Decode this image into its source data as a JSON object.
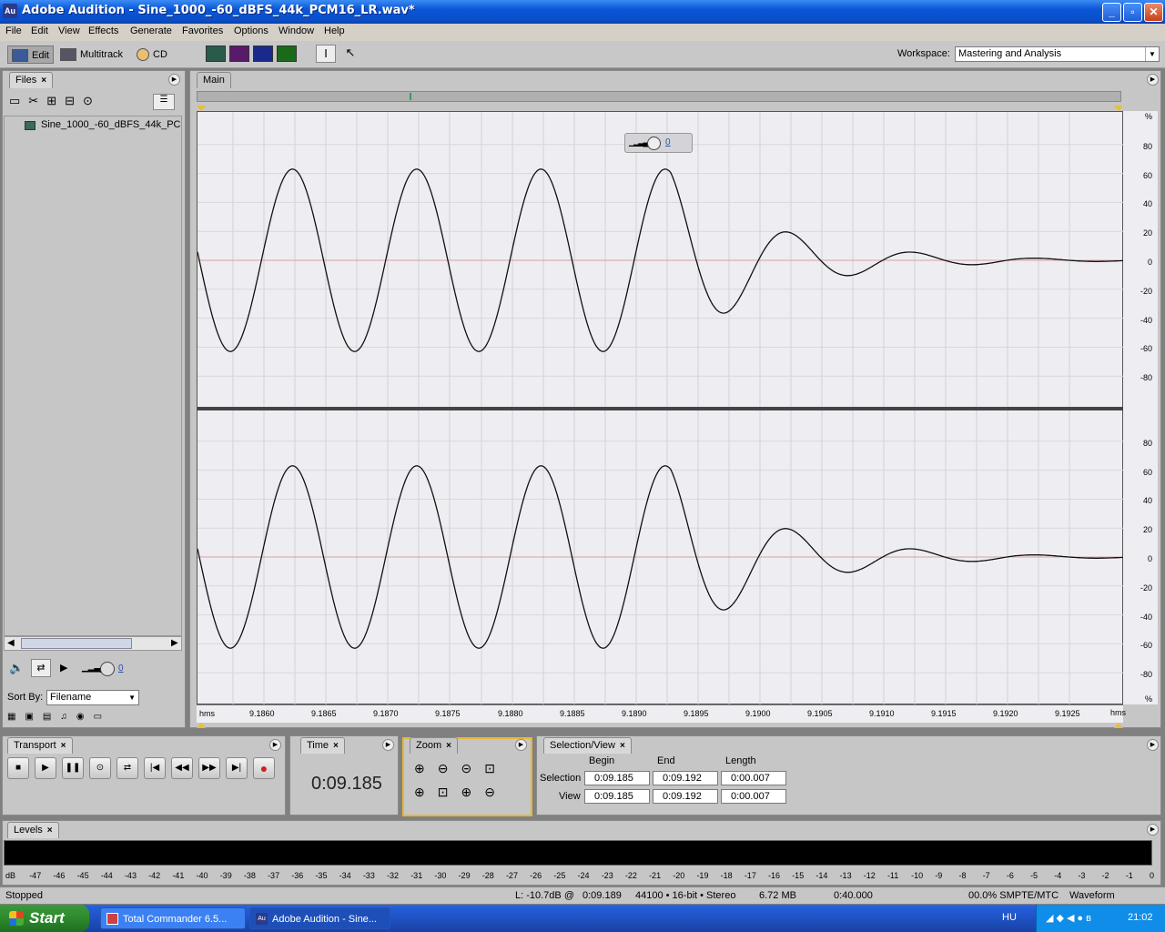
{
  "window": {
    "title": "Adobe Audition - Sine_1000_-60_dBFS_44k_PCM16_LR.wav*",
    "app_icon": "Au"
  },
  "menu": [
    "File",
    "Edit",
    "View",
    "Effects",
    "Generate",
    "Favorites",
    "Options",
    "Window",
    "Help"
  ],
  "toolbar": {
    "edit": "Edit",
    "multitrack": "Multitrack",
    "cd": "CD",
    "workspace_label": "Workspace:",
    "workspace_value": "Mastering and Analysis"
  },
  "files_panel": {
    "tab": "Files",
    "file": "Sine_1000_-60_dBFS_44k_PCM",
    "sort_label": "Sort By:",
    "sort_value": "Filename",
    "volume": "0"
  },
  "main_panel": {
    "tab": "Main",
    "overlay_volume": "0"
  },
  "waveform": {
    "y_labels_top": [
      "%",
      "80",
      "60",
      "40",
      "20",
      "0",
      "-20",
      "-40",
      "-60",
      "-80"
    ],
    "y_labels_bottom": [
      "80",
      "60",
      "40",
      "20",
      "0",
      "-20",
      "-40",
      "-60",
      "-80",
      "%"
    ],
    "x_unit": "hms",
    "x_ticks": [
      "9.1860",
      "9.1865",
      "9.1870",
      "9.1875",
      "9.1880",
      "9.1885",
      "9.1890",
      "9.1895",
      "9.1900",
      "9.1905",
      "9.1910",
      "9.1915",
      "9.1920",
      "9.1925"
    ],
    "peaks_note": "decaying sine"
  },
  "transport": {
    "tab": "Transport"
  },
  "time_panel": {
    "tab": "Time",
    "value": "0:09.185"
  },
  "zoom_panel": {
    "tab": "Zoom"
  },
  "selection_view": {
    "tab": "Selection/View",
    "col_begin": "Begin",
    "col_end": "End",
    "col_length": "Length",
    "row_selection": "Selection",
    "row_view": "View",
    "sel_begin": "0:09.185",
    "sel_end": "0:09.192",
    "sel_length": "0:00.007",
    "view_begin": "0:09.185",
    "view_end": "0:09.192",
    "view_length": "0:00.007"
  },
  "levels": {
    "tab": "Levels",
    "scale": [
      "dB",
      "-47",
      "-46",
      "-45",
      "-44",
      "-43",
      "-42",
      "-41",
      "-40",
      "-39",
      "-38",
      "-37",
      "-36",
      "-35",
      "-34",
      "-33",
      "-32",
      "-31",
      "-30",
      "-29",
      "-28",
      "-27",
      "-26",
      "-25",
      "-24",
      "-23",
      "-22",
      "-21",
      "-20",
      "-19",
      "-18",
      "-17",
      "-16",
      "-15",
      "-14",
      "-13",
      "-12",
      "-11",
      "-10",
      "-9",
      "-8",
      "-7",
      "-6",
      "-5",
      "-4",
      "-3",
      "-2",
      "-1",
      "0"
    ]
  },
  "status": {
    "state": "Stopped",
    "level": "L: -10.7dB @",
    "level_time": "0:09.189",
    "format": "44100 • 16-bit • Stereo",
    "size": "6.72 MB",
    "duration": "0:40.000",
    "smpte": "00.0% SMPTE/MTC",
    "view": "Waveform"
  },
  "taskbar": {
    "start": "Start",
    "items": [
      "Total Commander 6.5...",
      "Adobe Audition - Sine..."
    ],
    "lang": "HU",
    "clock": "21:02"
  }
}
